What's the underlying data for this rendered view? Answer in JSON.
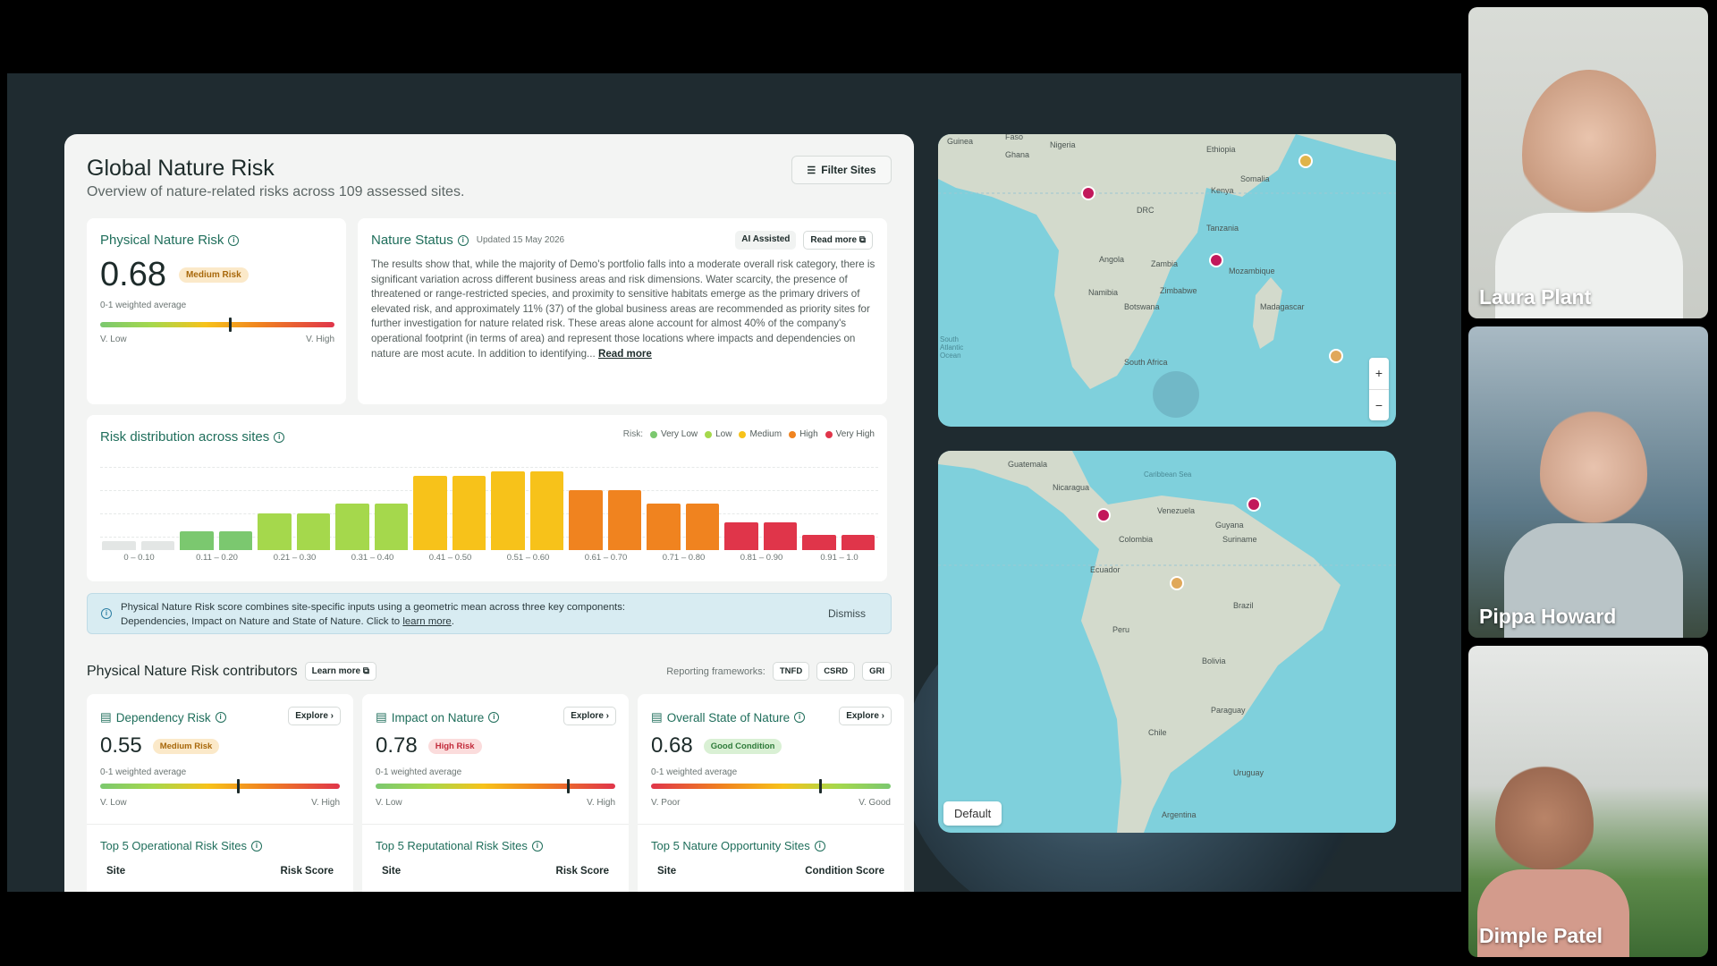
{
  "dashboard": {
    "title": "Global Nature Risk",
    "subtitle": "Overview of nature-related risks across 109 assessed sites.",
    "filter_label": "Filter Sites"
  },
  "physical_risk": {
    "title": "Physical Nature Risk",
    "value": "0.68",
    "badge": "Medium Risk",
    "caption": "0-1 weighted average",
    "low_label": "V. Low",
    "high_label": "V. High",
    "level": 0.55
  },
  "nature_status": {
    "title": "Nature Status",
    "updated": "Updated 15 May 2026",
    "ai_label": "AI Assisted",
    "read_more_button": "Read more",
    "body": "The results show that, while the majority of Demo's portfolio falls into a moderate overall risk category, there is significant variation across different business areas and risk dimensions. Water scarcity, the presence of threatened or range-restricted species, and proximity to sensitive habitats emerge as the primary drivers of elevated risk, and approximately 11% (37) of the global business areas are recommended as priority sites for further investigation for nature related risk. These areas alone account for almost 40% of the company's operational footprint (in terms of area) and represent those locations where impacts and dependencies on nature are most acute. In addition to identifying...",
    "read_more_link": "Read more"
  },
  "distribution": {
    "title": "Risk distribution across sites",
    "legend_prefix": "Risk:",
    "legend": [
      {
        "label": "Very Low",
        "color": "#7bc86f"
      },
      {
        "label": "Low",
        "color": "#a5d84c"
      },
      {
        "label": "Medium",
        "color": "#f7c21a"
      },
      {
        "label": "High",
        "color": "#f0831f"
      },
      {
        "label": "Very High",
        "color": "#e0354a"
      }
    ]
  },
  "chart_data": {
    "type": "bar",
    "title": "Risk distribution across sites",
    "categories": [
      "0 – 0.10",
      "0.11 – 0.20",
      "0.21 – 0.30",
      "0.31 – 0.40",
      "0.41 – 0.50",
      "0.51 – 0.60",
      "0.61 – 0.70",
      "0.71 – 0.80",
      "0.81 – 0.90",
      "0.91 – 1.0"
    ],
    "values": [
      1,
      1,
      2,
      2,
      4,
      4,
      5,
      5,
      8,
      8,
      8.5,
      8.5,
      6.5,
      6.5,
      5,
      5,
      3,
      3,
      1.6,
      1.6
    ],
    "bar_colors": [
      "#e3e6e5",
      "#e3e6e5",
      "#7bc86f",
      "#7bc86f",
      "#a5d84c",
      "#a5d84c",
      "#a5d84c",
      "#a5d84c",
      "#f7c21a",
      "#f7c21a",
      "#f7c21a",
      "#f7c21a",
      "#f0831f",
      "#f0831f",
      "#f0831f",
      "#f0831f",
      "#e0354a",
      "#e0354a",
      "#e0354a",
      "#e0354a"
    ],
    "ylim": [
      0,
      9
    ]
  },
  "banner": {
    "text_line1": "Physical Nature Risk score combines site-specific inputs using a geometric mean across three key components:",
    "text_line2": "Dependencies, Impact on Nature and State of Nature. Click to ",
    "link": "learn more",
    "dismiss": "Dismiss"
  },
  "contributors": {
    "title": "Physical Nature Risk contributors",
    "learn_more": "Learn more",
    "frameworks_label": "Reporting frameworks:",
    "frameworks": [
      "TNFD",
      "CSRD",
      "GRI"
    ],
    "cards": [
      {
        "title": "Dependency Risk",
        "explore": "Explore",
        "value": "0.55",
        "badge": "Medium Risk",
        "badge_bg": "#fbe9c9",
        "badge_fg": "#a8680b",
        "caption": "0-1 weighted average",
        "low": "V. Low",
        "high": "V. High",
        "level": 0.57,
        "reverse": false,
        "list_title": "Top 5 Operational Risk Sites",
        "col1": "Site",
        "col2": "Risk Score"
      },
      {
        "title": "Impact on Nature",
        "explore": "Explore",
        "value": "0.78",
        "badge": "High Risk",
        "badge_bg": "#fbdcdc",
        "badge_fg": "#c22b3b",
        "caption": "0-1 weighted average",
        "low": "V. Low",
        "high": "V. High",
        "level": 0.8,
        "reverse": false,
        "list_title": "Top 5 Reputational Risk Sites",
        "col1": "Site",
        "col2": "Risk Score"
      },
      {
        "title": "Overall State of Nature",
        "explore": "Explore",
        "value": "0.68",
        "badge": "Good Condition",
        "badge_bg": "#d9f0d4",
        "badge_fg": "#2f7b3a",
        "caption": "0-1 weighted average",
        "low": "V. Poor",
        "high": "V. Good",
        "level": 0.7,
        "reverse": true,
        "list_title": "Top 5 Nature Opportunity Sites",
        "col1": "Site",
        "col2": "Condition Score"
      }
    ]
  },
  "map_africa": {
    "labels": [
      "Guinea",
      "Faso",
      "Nigeria",
      "Ghana",
      "Ethiopia",
      "Somalia",
      "DRC",
      "Kenya",
      "Tanzania",
      "Angola",
      "Zambia",
      "Mozambique",
      "Namibia",
      "Zimbabwe",
      "Botswana",
      "Madagascar",
      "South Africa",
      "South Atlantic Ocean"
    ],
    "zoom_in": "+",
    "zoom_out": "−",
    "pin_colors": [
      "#c2185b",
      "#c2185b",
      "#e0b44a",
      "#e0a85a"
    ]
  },
  "map_samerica": {
    "labels": [
      "Guatemala",
      "Nicaragua",
      "Caribbean Sea",
      "Venezuela",
      "Guyana",
      "Suriname",
      "Colombia",
      "Ecuador",
      "Peru",
      "Brazil",
      "Bolivia",
      "Paraguay",
      "Chile",
      "Uruguay",
      "Argentina"
    ],
    "default_button": "Default",
    "pin_colors": [
      "#c2185b",
      "#c2185b",
      "#e0a85a"
    ]
  },
  "participants": [
    {
      "name": "Laura Plant"
    },
    {
      "name": "Pippa Howard"
    },
    {
      "name": "Dimple Patel"
    }
  ]
}
